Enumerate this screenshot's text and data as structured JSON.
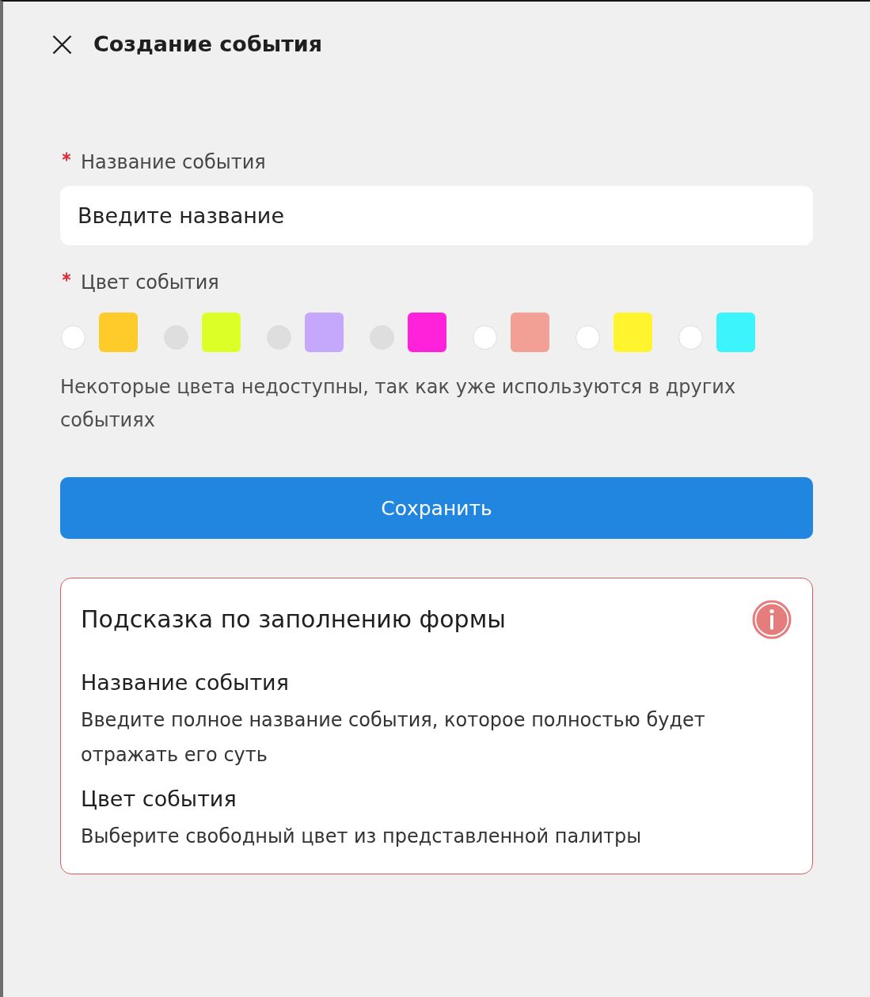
{
  "header": {
    "title": "Создание события"
  },
  "form": {
    "name_field": {
      "label": "Название события",
      "required": true,
      "placeholder": "Введите название"
    },
    "color_field": {
      "label": "Цвет события",
      "required": true,
      "options": [
        {
          "color": "#ffcb2a",
          "selected": false,
          "disabled": false
        },
        {
          "color": "#dcff28",
          "selected": false,
          "disabled": true
        },
        {
          "color": "#c5a8fb",
          "selected": false,
          "disabled": true
        },
        {
          "color": "#ff22da",
          "selected": false,
          "disabled": true
        },
        {
          "color": "#f2a095",
          "selected": false,
          "disabled": false
        },
        {
          "color": "#fff42e",
          "selected": false,
          "disabled": false
        },
        {
          "color": "#3cf4fc",
          "selected": false,
          "disabled": false
        }
      ],
      "note": "Некоторые цвета недоступны, так как уже используются в других событиях"
    },
    "save_button": {
      "label": "Сохранить"
    }
  },
  "hint_card": {
    "title": "Подсказка по заполнению формы",
    "sections": [
      {
        "heading": "Название события",
        "text": "Введите полное название события, которое полностью будет отражать его суть"
      },
      {
        "heading": "Цвет события",
        "text": "Выберите свободный цвет из представленной палитры"
      }
    ]
  }
}
